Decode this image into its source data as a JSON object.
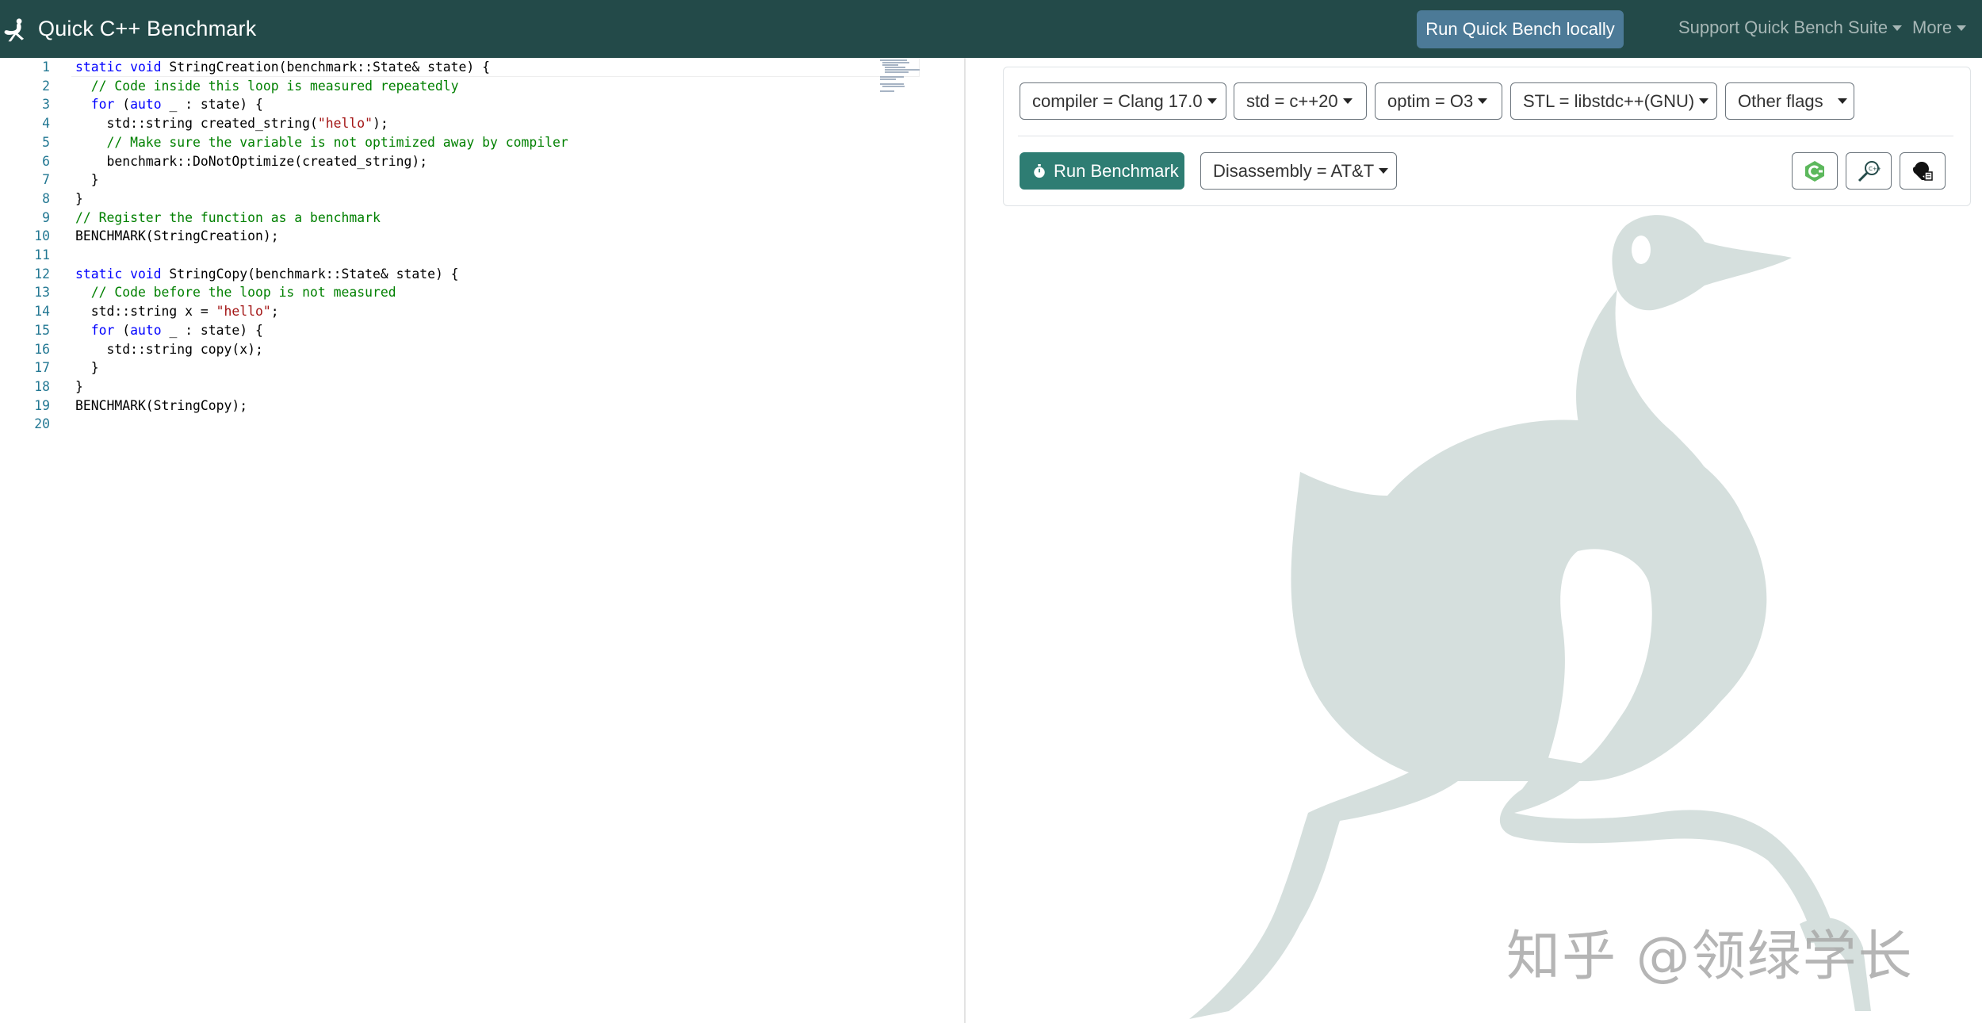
{
  "navbar": {
    "brand_title": "Quick C++ Benchmark",
    "run_local_label": "Run Quick Bench locally",
    "support_label": "Support Quick Bench Suite",
    "more_label": "More",
    "background_color": "#234a49",
    "run_local_color": "#4c7a97"
  },
  "editor": {
    "lines": [
      {
        "n": "1",
        "segments": [
          {
            "t": "static void",
            "c": "kw"
          },
          {
            "t": " StringCreation(benchmark::State& state) {",
            "c": ""
          }
        ]
      },
      {
        "n": "2",
        "segments": [
          {
            "t": "  // Code inside this loop is measured repeatedly",
            "c": "cm"
          }
        ]
      },
      {
        "n": "3",
        "segments": [
          {
            "t": "  ",
            "c": ""
          },
          {
            "t": "for",
            "c": "kw"
          },
          {
            "t": " (",
            "c": ""
          },
          {
            "t": "auto",
            "c": "kw"
          },
          {
            "t": " _ : state) {",
            "c": ""
          }
        ]
      },
      {
        "n": "4",
        "segments": [
          {
            "t": "    std::string created_string(",
            "c": ""
          },
          {
            "t": "\"hello\"",
            "c": "st"
          },
          {
            "t": ");",
            "c": ""
          }
        ]
      },
      {
        "n": "5",
        "segments": [
          {
            "t": "    // Make sure the variable is not optimized away by compiler",
            "c": "cm"
          }
        ]
      },
      {
        "n": "6",
        "segments": [
          {
            "t": "    benchmark::DoNotOptimize(created_string);",
            "c": ""
          }
        ]
      },
      {
        "n": "7",
        "segments": [
          {
            "t": "  }",
            "c": ""
          }
        ]
      },
      {
        "n": "8",
        "segments": [
          {
            "t": "}",
            "c": ""
          }
        ]
      },
      {
        "n": "9",
        "segments": [
          {
            "t": "// Register the function as a benchmark",
            "c": "cm"
          }
        ]
      },
      {
        "n": "10",
        "segments": [
          {
            "t": "BENCHMARK(StringCreation);",
            "c": ""
          }
        ]
      },
      {
        "n": "11",
        "segments": [
          {
            "t": "",
            "c": ""
          }
        ]
      },
      {
        "n": "12",
        "segments": [
          {
            "t": "static void",
            "c": "kw"
          },
          {
            "t": " StringCopy(benchmark::State& state) {",
            "c": ""
          }
        ]
      },
      {
        "n": "13",
        "segments": [
          {
            "t": "  // Code before the loop is not measured",
            "c": "cm"
          }
        ]
      },
      {
        "n": "14",
        "segments": [
          {
            "t": "  std::string x = ",
            "c": ""
          },
          {
            "t": "\"hello\"",
            "c": "st"
          },
          {
            "t": ";",
            "c": ""
          }
        ]
      },
      {
        "n": "15",
        "segments": [
          {
            "t": "  ",
            "c": ""
          },
          {
            "t": "for",
            "c": "kw"
          },
          {
            "t": " (",
            "c": ""
          },
          {
            "t": "auto",
            "c": "kw"
          },
          {
            "t": " _ : state) {",
            "c": ""
          }
        ]
      },
      {
        "n": "16",
        "segments": [
          {
            "t": "    std::string copy(x);",
            "c": ""
          }
        ]
      },
      {
        "n": "17",
        "segments": [
          {
            "t": "  }",
            "c": ""
          }
        ]
      },
      {
        "n": "18",
        "segments": [
          {
            "t": "}",
            "c": ""
          }
        ]
      },
      {
        "n": "19",
        "segments": [
          {
            "t": "BENCHMARK(StringCopy);",
            "c": ""
          }
        ]
      },
      {
        "n": "20",
        "segments": [
          {
            "t": "",
            "c": ""
          }
        ]
      }
    ]
  },
  "options": {
    "compiler_label": "compiler = Clang 17.0",
    "std_label": "std = c++20",
    "optim_label": "optim = O3",
    "stl_label": "STL = libstdc++(GNU)",
    "other_flags_label": "Other flags",
    "run_benchmark_label": "Run Benchmark",
    "disassembly_label": "Disassembly = AT&T",
    "run_benchmark_color": "#2e7d73"
  },
  "icons": {
    "brand": "ostrich-logo-icon",
    "run": "stopwatch-icon",
    "tool1": "cpp-logo-icon",
    "tool2": "search-cpp-icon",
    "tool3": "quickbench-bird-icon"
  },
  "watermark": {
    "text": "知乎 @领绿学长"
  }
}
